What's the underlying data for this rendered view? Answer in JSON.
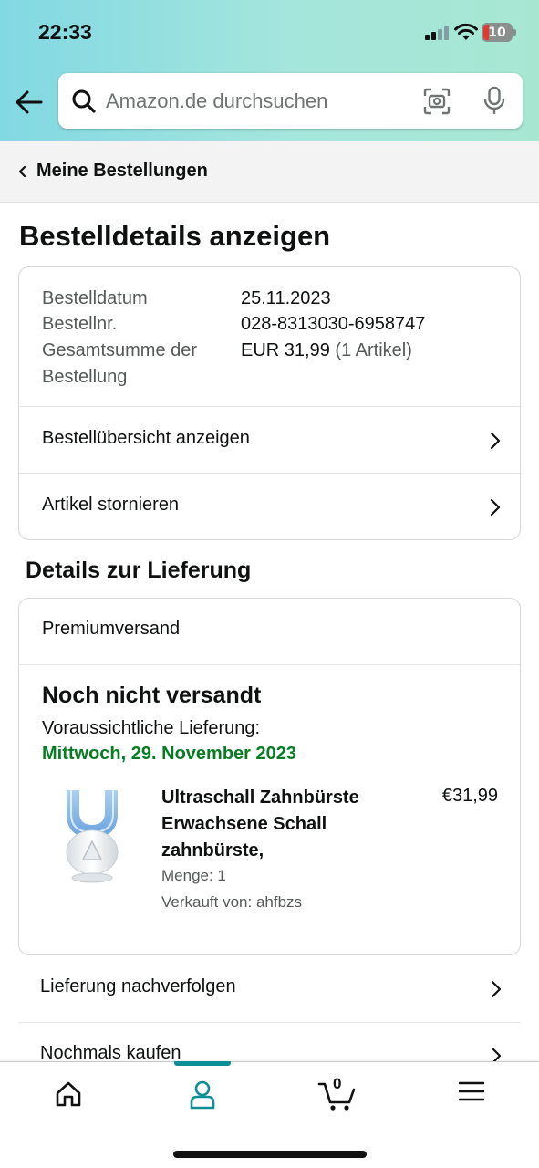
{
  "status_bar": {
    "time": "22:33",
    "battery": "10"
  },
  "search": {
    "placeholder": "Amazon.de durchsuchen"
  },
  "breadcrumb": {
    "label": "Meine Bestellungen"
  },
  "page_title": "Bestelldetails anzeigen",
  "order_summary": {
    "date_label": "Bestelldatum",
    "date_value": "25.11.2023",
    "number_label": "Bestellnr.",
    "number_value": "028-8313030-6958747",
    "total_label_line1": "Gesamtsumme der",
    "total_label_line2": "Bestellung",
    "total_value": "EUR 31,99",
    "total_items": "(1 Artikel)"
  },
  "order_links": [
    {
      "label": "Bestellübersicht anzeigen"
    },
    {
      "label": "Artikel stornieren"
    }
  ],
  "delivery": {
    "section_title": "Details zur Lieferung",
    "shipping_method": "Premiumversand",
    "status": "Noch nicht versandt",
    "eta_label": "Voraussichtliche Lieferung:",
    "eta_date": "Mittwoch, 29. November 2023",
    "eta_color": "#067d22"
  },
  "product": {
    "name": "Ultraschall Zahnbürste Erwachsene Schall zahnbürste,",
    "price": "€31,99",
    "quantity": "Menge: 1",
    "seller": "Verkauft von: ahfbzs",
    "image_icon": "toothbrush-product-image"
  },
  "action_rows": [
    {
      "label": "Lieferung nachverfolgen"
    },
    {
      "label": "Nochmals kaufen"
    }
  ],
  "bottom_nav": {
    "items": [
      "home-icon",
      "account-icon",
      "cart-icon",
      "menu-icon"
    ],
    "active": "account-icon",
    "cart_count": "0",
    "accent_color": "#0d8f96"
  },
  "colors": {
    "header_gradient_start": "#82d8e3",
    "header_gradient_end": "#a7e7d2",
    "breadcrumb_bg": "#f3f3f3"
  }
}
